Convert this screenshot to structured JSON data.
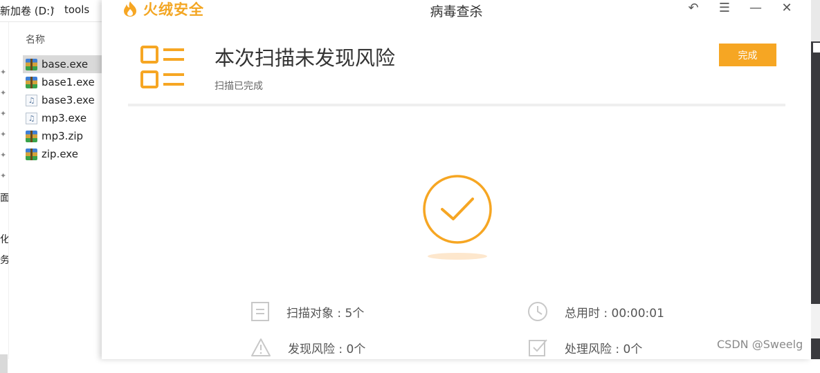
{
  "explorer": {
    "path_drive": "新加卷 (D:)",
    "path_sep": "›",
    "path_folder": "tools",
    "column_header": "名称",
    "files": [
      {
        "name": "base.exe",
        "icon": "archive-icon",
        "selected": true
      },
      {
        "name": "base1.exe",
        "icon": "archive-icon",
        "selected": false
      },
      {
        "name": "base3.exe",
        "icon": "audio-file-icon",
        "selected": false
      },
      {
        "name": "mp3.exe",
        "icon": "audio-file-icon",
        "selected": false
      },
      {
        "name": "mp3.zip",
        "icon": "archive-icon",
        "selected": false
      },
      {
        "name": "zip.exe",
        "icon": "archive-icon",
        "selected": false
      }
    ],
    "strip_chars": [
      "面",
      "化",
      "务"
    ]
  },
  "app": {
    "brand": "火绒安全",
    "window_title": "病毒查杀",
    "controls": {
      "back": "↶",
      "menu": "☰",
      "minimize": "—",
      "close": "✕"
    },
    "accent_color": "#f6a623"
  },
  "result": {
    "headline": "本次扫描未发现风险",
    "subline": "扫描已完成",
    "done_button": "完成"
  },
  "stats": {
    "scanned": "扫描对象 : 5个",
    "elapsed": "总用时 : 00:00:01",
    "found": "发现风险 : 0个",
    "handled": "处理风险 : 0个"
  },
  "watermark": "CSDN @Sweelg"
}
